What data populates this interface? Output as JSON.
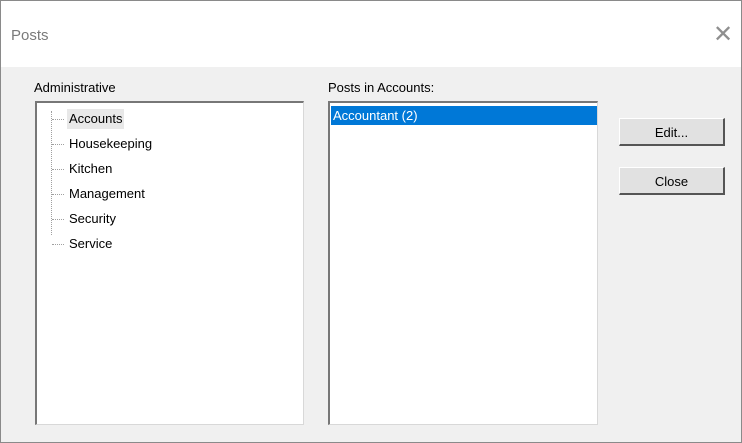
{
  "window": {
    "title": "Posts",
    "close_glyph": "✕"
  },
  "left_panel": {
    "label": "Administrative",
    "items": [
      {
        "label": "Accounts",
        "selected": true
      },
      {
        "label": "Housekeeping",
        "selected": false
      },
      {
        "label": "Kitchen",
        "selected": false
      },
      {
        "label": "Management",
        "selected": false
      },
      {
        "label": "Security",
        "selected": false
      },
      {
        "label": "Service",
        "selected": false
      }
    ]
  },
  "right_panel": {
    "label": "Posts in Accounts:",
    "items": [
      {
        "label": "Accountant (2)",
        "selected": true
      }
    ]
  },
  "buttons": {
    "edit_label": "Edit...",
    "close_label": "Close"
  },
  "colors": {
    "selection": "#0078d7",
    "dialog_bg": "#f0f0f0"
  }
}
